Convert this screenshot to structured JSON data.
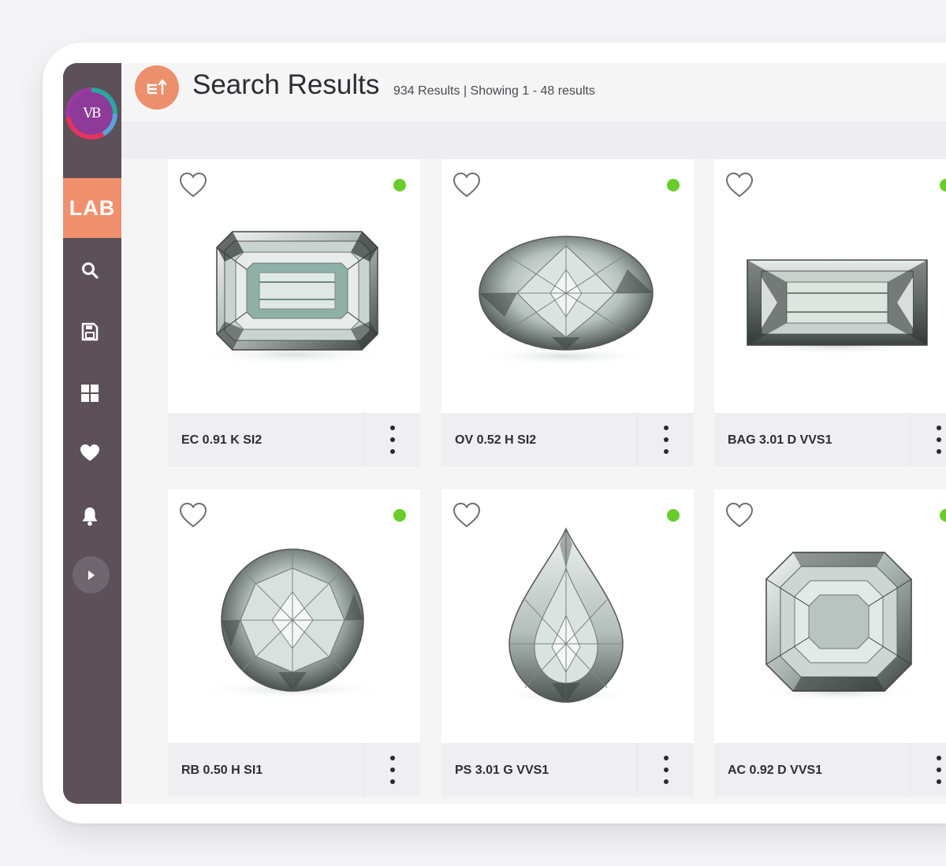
{
  "sidebar": {
    "logo_text": "VB",
    "brand_badge": "LAB",
    "nav_items": [
      {
        "icon": "search-icon"
      },
      {
        "icon": "save-icon"
      },
      {
        "icon": "grid-icon"
      },
      {
        "icon": "heart-icon"
      },
      {
        "icon": "bell-icon"
      }
    ],
    "expand_icon": "chevron-right-icon"
  },
  "header": {
    "title": "Search Results",
    "results_info": "934 Results | Showing 1 - 48 results",
    "sort_icon": "sort-icon"
  },
  "colors": {
    "sidebar": "#5c5059",
    "accent": "#f0906e",
    "available": "#69cc2a"
  },
  "results": [
    {
      "title": "EC 0.91 K SI2",
      "shape": "emerald",
      "available": true
    },
    {
      "title": "OV 0.52 H SI2",
      "shape": "oval",
      "available": true
    },
    {
      "title": "BAG 3.01 D VVS1",
      "shape": "baguette",
      "available": true
    },
    {
      "title": "RB 0.50 H SI1",
      "shape": "round",
      "available": true
    },
    {
      "title": "PS 3.01 G VVS1",
      "shape": "pear",
      "available": true
    },
    {
      "title": "AC 0.92 D VVS1",
      "shape": "asscher",
      "available": true
    }
  ]
}
